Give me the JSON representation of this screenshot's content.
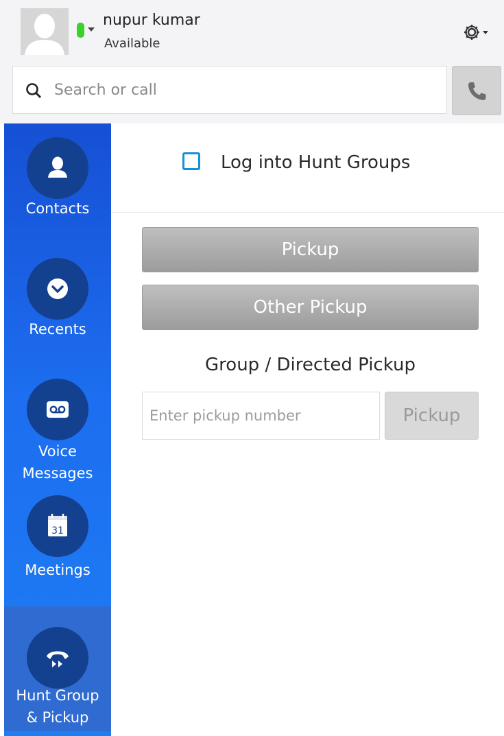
{
  "header": {
    "user_name": "nupur kumar",
    "user_status": "Available",
    "presence_color": "#3bd12a",
    "settings_icon": "gear-icon"
  },
  "search": {
    "placeholder": "Search or call",
    "value": ""
  },
  "sidebar": {
    "items": [
      {
        "label": "Contacts",
        "icon": "person-icon",
        "active": false
      },
      {
        "label": "Recents",
        "icon": "chevron-down-circle-icon",
        "active": false
      },
      {
        "label_line1": "Voice",
        "label_line2": "Messages",
        "icon": "voicemail-icon",
        "active": false
      },
      {
        "label": "Meetings",
        "icon": "calendar-icon",
        "calendar_day": "31",
        "active": false
      },
      {
        "label_line1": "Hunt Group",
        "label_line2": "& Pickup",
        "icon": "handset-pickup-icon",
        "active": true
      }
    ]
  },
  "hunt_groups": {
    "checkbox_label": "Log into Hunt Groups",
    "checked": false
  },
  "pickup": {
    "pickup_label": "Pickup",
    "other_pickup_label": "Other Pickup",
    "section_title": "Group / Directed Pickup",
    "input_placeholder": "Enter pickup number",
    "input_value": "",
    "submit_label": "Pickup"
  },
  "colors": {
    "sidebar_top": "#1650d4",
    "sidebar_bottom": "#1d7ef4",
    "nav_circle": "#14418f",
    "checkbox_border": "#1a8fd6",
    "button_gray": "#a8a8a8"
  }
}
